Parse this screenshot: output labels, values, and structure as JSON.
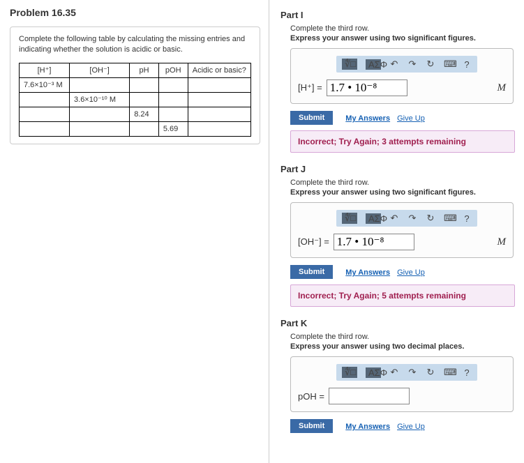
{
  "problem": {
    "title": "Problem 16.35",
    "instructions": "Complete the following table by calculating the missing entries and indicating whether the solution is acidic or basic.",
    "headers": [
      "[H⁺]",
      "[OH⁻]",
      "pH",
      "pOH",
      "Acidic or basic?"
    ],
    "rows": [
      [
        "7.6×10⁻³ M",
        "",
        "",
        "",
        ""
      ],
      [
        "",
        "3.6×10⁻¹⁰ M",
        "",
        "",
        ""
      ],
      [
        "",
        "",
        "8.24",
        "",
        ""
      ],
      [
        "",
        "",
        "",
        "5.69",
        ""
      ]
    ]
  },
  "parts": [
    {
      "title": "Part I",
      "sub": "Complete the third row.",
      "fmt": "Express your answer using two significant figures.",
      "var": "[H⁺] =",
      "value": "1.7 • 10⁻⁸",
      "unit": "M",
      "feedback": "Incorrect; Try Again; 3 attempts remaining"
    },
    {
      "title": "Part J",
      "sub": "Complete the third row.",
      "fmt": "Express your answer using two significant figures.",
      "var": "[OH⁻] =",
      "value": "1.7 • 10⁻⁸",
      "unit": "M",
      "feedback": "Incorrect; Try Again; 5 attempts remaining"
    },
    {
      "title": "Part K",
      "sub": "Complete the third row.",
      "fmt": "Express your answer using two decimal places.",
      "var": "pOH =",
      "value": "",
      "unit": "",
      "feedback": ""
    }
  ],
  "toolbar": {
    "t1": "∜□",
    "t2": "ΑΣΦ",
    "undo": "↶",
    "redo": "↷",
    "reset": "↻",
    "help": "?",
    "kb": "⌨"
  },
  "buttons": {
    "submit": "Submit",
    "myans": "My Answers",
    "giveup": "Give Up"
  }
}
